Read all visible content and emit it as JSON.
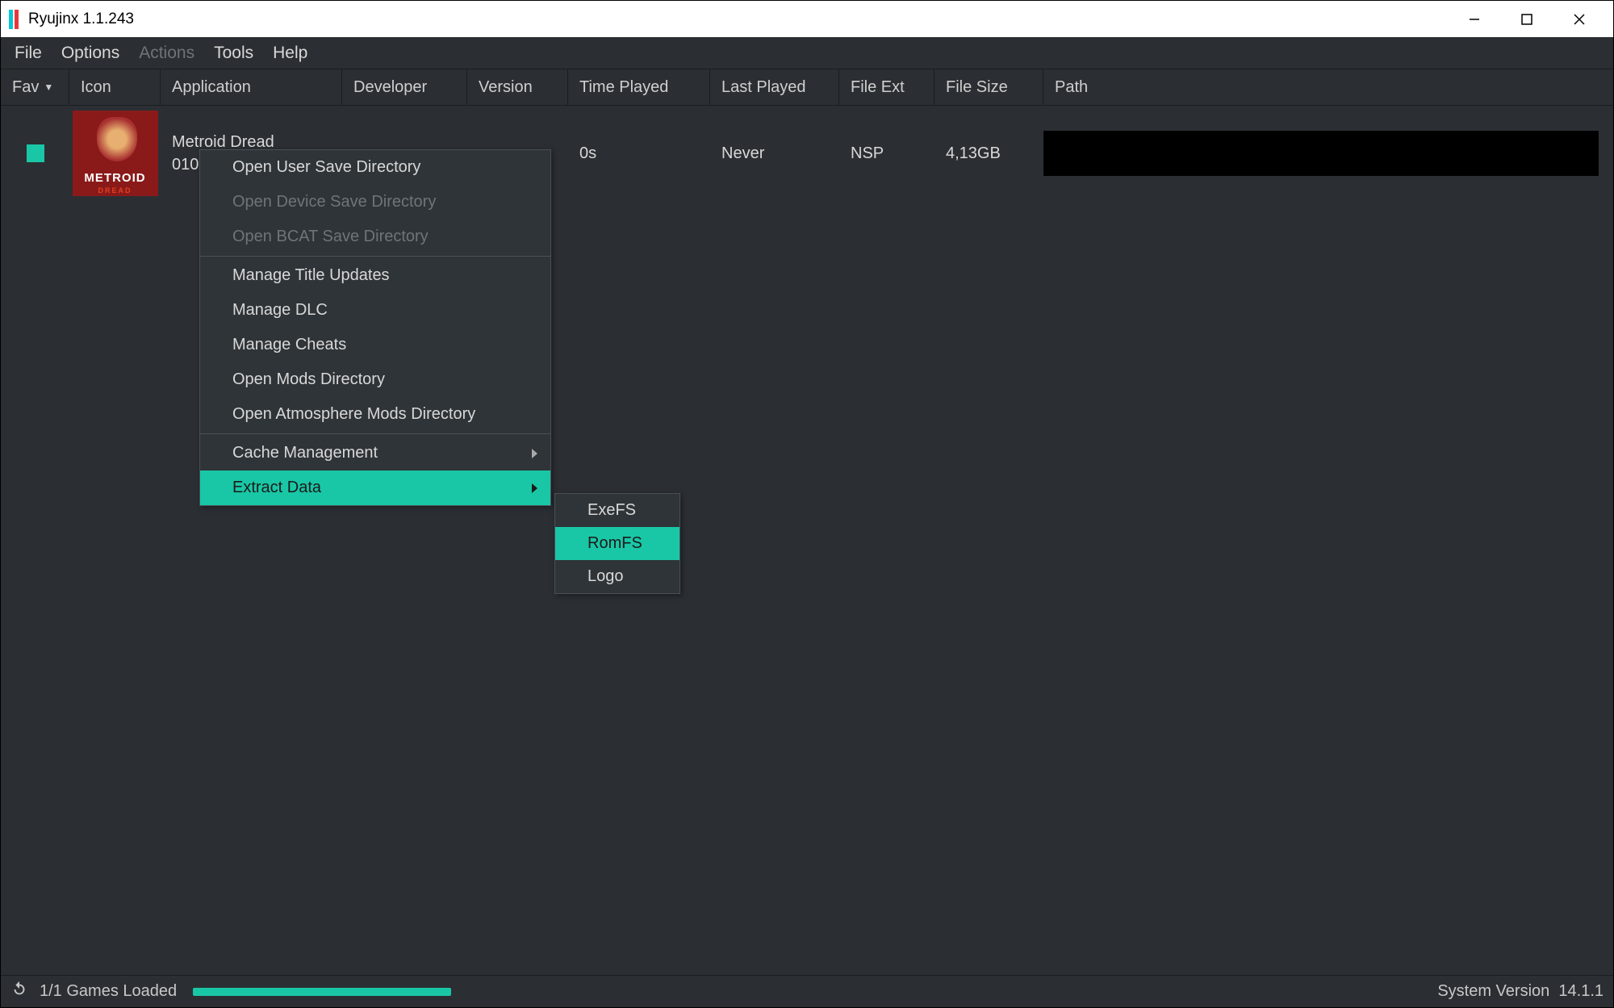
{
  "title": "Ryujinx 1.1.243",
  "menu": {
    "file": "File",
    "options": "Options",
    "actions": "Actions",
    "tools": "Tools",
    "help": "Help"
  },
  "columns": {
    "fav": "Fav",
    "icon": "Icon",
    "app": "Application",
    "dev": "Developer",
    "ver": "Version",
    "time": "Time Played",
    "last": "Last Played",
    "ext": "File Ext",
    "size": "File Size",
    "path": "Path"
  },
  "game": {
    "name": "Metroid Dread",
    "id": "010",
    "icon_top": "METROID",
    "icon_bot": "DREAD",
    "time": "0s",
    "last": "Never",
    "ext": "NSP",
    "size": "4,13GB"
  },
  "ctx": {
    "open_user": "Open User Save Directory",
    "open_device": "Open Device Save Directory",
    "open_bcat": "Open BCAT Save Directory",
    "manage_updates": "Manage Title Updates",
    "manage_dlc": "Manage DLC",
    "manage_cheats": "Manage Cheats",
    "open_mods": "Open Mods Directory",
    "open_atmos": "Open Atmosphere Mods Directory",
    "cache": "Cache Management",
    "extract": "Extract Data"
  },
  "extract_sub": {
    "exefs": "ExeFS",
    "romfs": "RomFS",
    "logo": "Logo"
  },
  "status": {
    "loaded": "1/1 Games Loaded",
    "sys_label": "System Version",
    "sys_ver": "14.1.1"
  }
}
